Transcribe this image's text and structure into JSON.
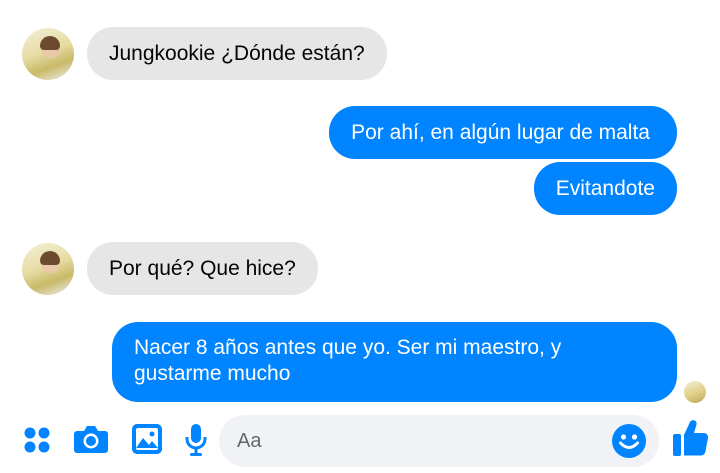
{
  "messages": [
    {
      "sender": "them",
      "text": "Jungkookie ¿Dónde están?"
    },
    {
      "sender": "me",
      "text": "Por ahí, en algún lugar de malta"
    },
    {
      "sender": "me",
      "text": "Evitandote"
    },
    {
      "sender": "them",
      "text": "Por qué? Que hice?"
    },
    {
      "sender": "me",
      "lines": [
        "Nacer 8 años antes que yo. Ser mi maestro, y",
        "gustarme mucho"
      ]
    }
  ],
  "composer": {
    "placeholder": "Aa",
    "icons": [
      "apps-icon",
      "camera-icon",
      "image-icon",
      "microphone-icon",
      "emoji-icon",
      "thumbs-up-icon"
    ]
  },
  "colors": {
    "accent": "#0084ff",
    "incoming_bubble": "#e6e6e6",
    "input_background": "#f0f2f5"
  }
}
